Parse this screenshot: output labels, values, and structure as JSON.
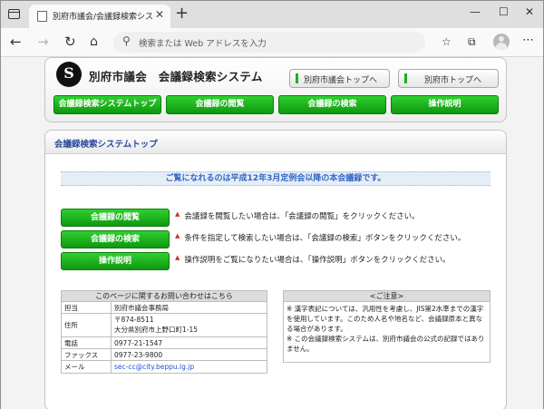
{
  "browser": {
    "tab_title": "別府市議会/会議録検索システム",
    "tab_close": "✕",
    "new_tab": "+",
    "address_placeholder": "検索または Web アドレスを入力"
  },
  "header": {
    "logo_glyph": "S",
    "site_title": "別府市議会　会議録検索システム",
    "links": [
      "別府市議会トップへ",
      "別府市トップへ"
    ],
    "menu": [
      "会議録検索システムトップ",
      "会議録の閲覧",
      "会議録の検索",
      "操作説明"
    ]
  },
  "main": {
    "section_title": "会議録検索システムトップ",
    "notice": "ご覧になれるのは平成12年3月定例会以降の本会議録です。",
    "actions": [
      {
        "label": "会議録の閲覧",
        "desc": "会議録を閲覧したい場合は、「会議録の閲覧」をクリックください。"
      },
      {
        "label": "会議録の検索",
        "desc": "条件を指定して検索したい場合は、「会議録の検索」ボタンをクリックください。"
      },
      {
        "label": "操作説明",
        "desc": "操作説明をご覧になりたい場合は、「操作説明」ボタンをクリックください。"
      }
    ],
    "action_mark": "▲"
  },
  "contact": {
    "title": "このページに関するお問い合わせはこちら",
    "rows": [
      {
        "key": "担当",
        "value": "別府市議会事務局"
      },
      {
        "key": "住所",
        "value": "〒874-8511",
        "value2": "大分県別府市上野口町1-15"
      },
      {
        "key": "電話",
        "value": "0977-21-1547"
      },
      {
        "key": "ファックス",
        "value": "0977-23-9800"
      },
      {
        "key": "メール",
        "value": "sec-cc@city.beppu.lg.jp"
      }
    ]
  },
  "caution": {
    "title": "<ご注意>",
    "lines": [
      "※ 漢字表記については、汎用性を考慮し、JIS第2水準までの漢字を使用しています。このため人名や地名など、会議録原本と異なる場合があります。",
      "※ この会議録検索システムは、別府市議会の公式の記録ではありません。"
    ]
  },
  "colors": {
    "accent_green": "#1db01d",
    "title_blue": "#2a4a9a",
    "notice_blue": "#3366c4"
  }
}
